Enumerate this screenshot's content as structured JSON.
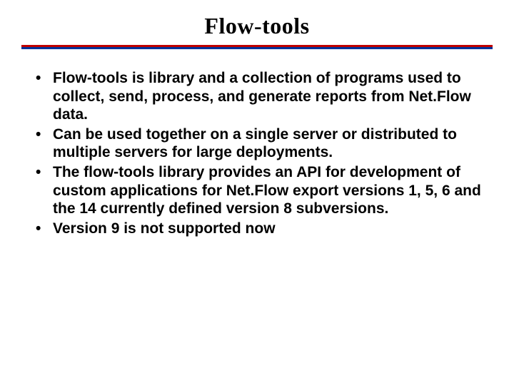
{
  "title": "Flow-tools",
  "bullets": [
    "Flow-tools  is  library  and  a collection of programs used to collect, send, process, and generate reports from Net.Flow data.",
    "Can be  used together on a single server or distributed to multiple servers for large deployments.",
    "The flow-tools library  provides  an  API  for development  of  custom  applications for Net.Flow export versions 1, 5, 6 and the 14 currently defined version 8 subversions.",
    "Version 9 is not supported now"
  ]
}
